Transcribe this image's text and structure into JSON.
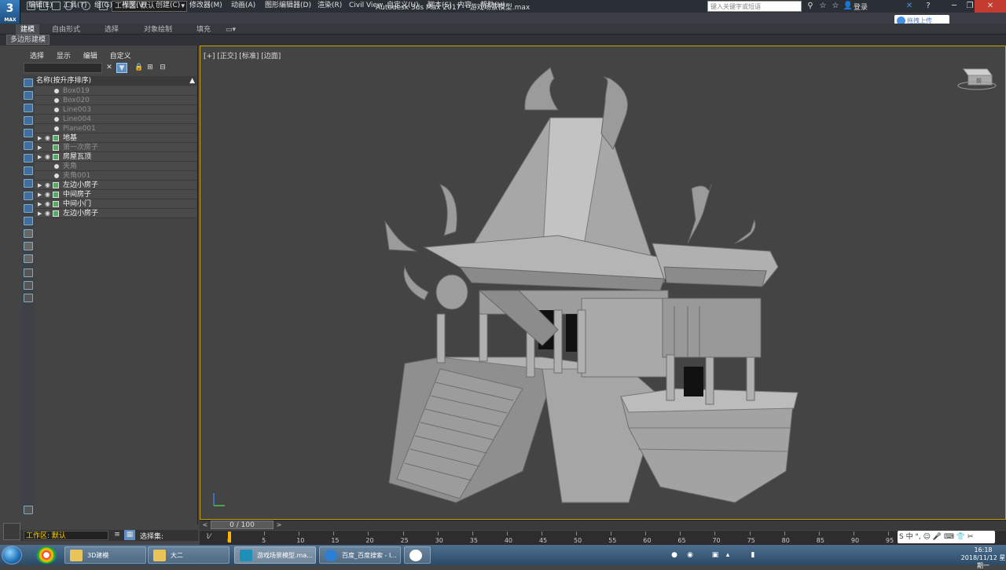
{
  "window": {
    "app_logo_num": "3",
    "app_logo_label": "MAX",
    "workspace_label": "工作区: 默认",
    "title": "Autodesk 3ds Max 2017",
    "file_name": "游戏场景模型.max",
    "search_placeholder": "键入关键字或短语",
    "login_label": "登录"
  },
  "menu": [
    "编辑(E)",
    "工具(T)",
    "组(G)",
    "视图(V)",
    "创建(C)",
    "修改器(M)",
    "动画(A)",
    "图形编辑器(D)",
    "渲染(R)",
    "Civil View",
    "自定义(U)",
    "脚本(S)",
    "内容",
    "帮助(H)"
  ],
  "upload_button": "拖拽上传",
  "ribbon": {
    "tabs": [
      "建模",
      "自由形式",
      "选择",
      "对象绘制",
      "填充"
    ],
    "sub_tab": "多边形建模"
  },
  "explorer": {
    "menu": [
      "选择",
      "显示",
      "编辑",
      "自定义"
    ],
    "header": "名称(按升序排序)",
    "header_sort": "▲",
    "rows": [
      {
        "label": "Box019",
        "state": "dim",
        "kind": "dot"
      },
      {
        "label": "Box020",
        "state": "dim",
        "kind": "dot"
      },
      {
        "label": "Line003",
        "state": "dim",
        "kind": "dot"
      },
      {
        "label": "Line004",
        "state": "dim",
        "kind": "dot"
      },
      {
        "label": "Plane001",
        "state": "dim",
        "kind": "dot"
      },
      {
        "label": "地基",
        "state": "bright",
        "kind": "group"
      },
      {
        "label": "第一次房子",
        "state": "dim",
        "kind": "group-noeye"
      },
      {
        "label": "房屋瓦顶",
        "state": "bright",
        "kind": "group"
      },
      {
        "label": "夹角",
        "state": "dim",
        "kind": "dot"
      },
      {
        "label": "夹角001",
        "state": "dim",
        "kind": "dot"
      },
      {
        "label": "左边小房子",
        "state": "bright",
        "kind": "group"
      },
      {
        "label": "中间房子",
        "state": "bright",
        "kind": "group"
      },
      {
        "label": "中间小门",
        "state": "bright",
        "kind": "group"
      },
      {
        "label": "左边小房子",
        "state": "bright",
        "kind": "group"
      }
    ],
    "workspace_bottom": "工作区: 默认",
    "selection_set_label": "选择集:"
  },
  "viewport": {
    "label": "[+] [正交] [标准] [边面]",
    "cube_label": "前"
  },
  "timeline": {
    "frame_display": "0 / 100",
    "ticks": [
      "0",
      "5",
      "10",
      "15",
      "20",
      "25",
      "30",
      "35",
      "40",
      "45",
      "50",
      "55",
      "60",
      "65",
      "70",
      "75",
      "80",
      "85",
      "90",
      "95"
    ]
  },
  "taskbar": {
    "buttons": [
      {
        "label": "3D建模",
        "icon_color": "#e9c45a"
      },
      {
        "label": "大二",
        "icon_color": "#e9c45a"
      },
      {
        "label": "游戏场景模型.ma...",
        "icon_color": "#1d8fb8"
      },
      {
        "label": "百度_百度搜索 - I...",
        "icon_color": "#2d7fd6"
      }
    ],
    "time": "16:18",
    "date": "2018/11/12 星期一",
    "ime": "S 中 °, ☺ 🎤 ⌨ 👕 ✂"
  },
  "colors": {
    "viewport_border": "#c8a000",
    "track_marker": "#ffb400",
    "close_button": "#c43b2f"
  }
}
